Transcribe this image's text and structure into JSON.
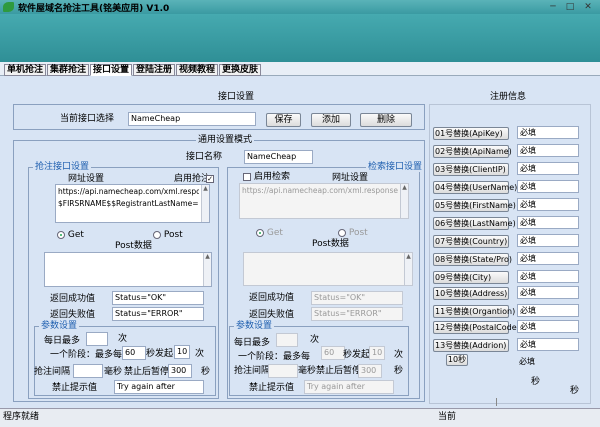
{
  "window": {
    "title": "软件屋域名抢注工具(铭美应用)  V1.0",
    "btn_min": "─",
    "btn_max": "□",
    "btn_close": "✕"
  },
  "tabs": [
    "单机抢注",
    "集群抢注",
    "接口设置",
    "登陆注册",
    "视频教程",
    "更换皮肤"
  ],
  "interface": {
    "section_title": "接口设置",
    "current_label": "当前接口选择",
    "current_value": "NameCheap",
    "save": "保存",
    "add": "添加",
    "delete": "删除"
  },
  "general": {
    "title": "通用设置模式",
    "name_label": "接口名称",
    "name_value": "NameCheap"
  },
  "grab": {
    "legend": "抢注接口设置",
    "url_label": "网址设置",
    "enable_label": "启用抢注",
    "url_line1": "https://api.namecheap.com/xml.response?ApiUse",
    "url_line2": "$FIRSRNAME$$RegistrantLastName=Smitha$Re",
    "get": "Get",
    "post": "Post",
    "post_data": "Post数据",
    "success_label": "返回成功值",
    "success_value": "Status=\"OK\"",
    "fail_label": "返回失败值",
    "fail_value": "Status=\"ERROR\"",
    "params_legend": "参数设置",
    "daily_label": "每日最多",
    "daily_unit": "次",
    "stage_label": "一个阶段：最多每",
    "stage_value": "60",
    "concurrent_label": "秒发起",
    "concurrent_value": "10",
    "concurrent_unit": "次",
    "interval_label": "抢注间隔",
    "interval_unit": "毫秒",
    "pause_label": "禁止后暂停",
    "pause_value": "300",
    "pause_unit": "秒",
    "forbid_label": "禁止提示值",
    "forbid_value": "Try again after"
  },
  "search": {
    "legend": "检索接口设置",
    "url_label": "网址设置",
    "enable_label": "启用检索",
    "url_line1": "https://api.namecheap.com/xml.response?ApiUse",
    "get": "Get",
    "post": "Post",
    "post_data": "Post数据",
    "success_label": "返回成功值",
    "success_value": "Status=\"OK\"",
    "fail_label": "返回失败值",
    "fail_value": "Status=\"ERROR\"",
    "params_legend": "参数设置",
    "daily_label": "每日最多",
    "daily_unit": "次",
    "stage_label": "一个阶段：最多每",
    "stage_value": "60",
    "concurrent_label": "秒发起",
    "concurrent_value": "10",
    "concurrent_unit": "次",
    "interval_label": "抢注间隔",
    "interval_unit": "毫秒",
    "pause_label": "禁止后暂停",
    "pause_value": "300",
    "pause_unit": "秒",
    "forbid_label": "禁止提示值",
    "forbid_value": "Try again after"
  },
  "register": {
    "title": "注册信息",
    "items": [
      {
        "label": "01号替换(ApiKey)",
        "value": "必填"
      },
      {
        "label": "02号替换(ApiName)",
        "value": "必填"
      },
      {
        "label": "03号替换(ClientIP)",
        "value": "必填"
      },
      {
        "label": "04号替换(UserName)",
        "value": "必填"
      },
      {
        "label": "05号替换(FirstName)",
        "value": "必填"
      },
      {
        "label": "06号替换(LastName)",
        "value": "必填"
      },
      {
        "label": "07号替换(Country)",
        "value": "必填"
      },
      {
        "label": "08号替换(State/Pro)",
        "value": "必填"
      },
      {
        "label": "09号替换(City)",
        "value": "必填"
      },
      {
        "label": "10号替换(Address)",
        "value": "必填"
      },
      {
        "label": "11号替换(Organtion)",
        "value": "必填"
      },
      {
        "label": "12号替换(PostalCode)",
        "value": "必填"
      },
      {
        "label": "13号替换(Addrion)",
        "value": "必填"
      }
    ],
    "extra_btn": "10秒",
    "sec1": "秒",
    "sec2": "秒"
  },
  "status": {
    "left": "程序就绪",
    "right": "当前"
  }
}
